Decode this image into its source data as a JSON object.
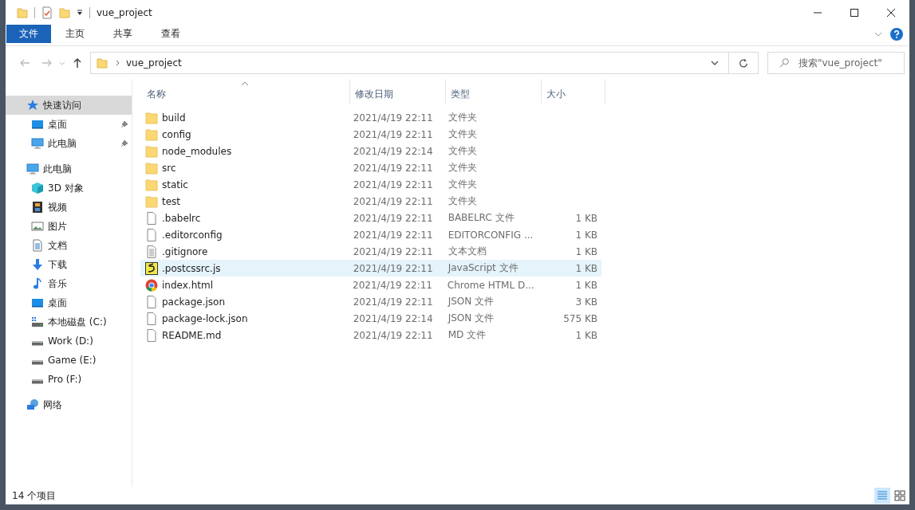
{
  "window": {
    "title": "vue_project"
  },
  "ribbon": {
    "tabs": [
      {
        "label": "文件",
        "selected": true
      },
      {
        "label": "主页",
        "selected": false
      },
      {
        "label": "共享",
        "selected": false
      },
      {
        "label": "查看",
        "selected": false
      }
    ]
  },
  "address": {
    "crumb": "vue_project"
  },
  "search": {
    "placeholder": "搜索\"vue_project\""
  },
  "sidebar": {
    "items": [
      {
        "label": "快速访问",
        "kind": "star",
        "selected": true,
        "pinned": false,
        "children": [
          {
            "label": "桌面",
            "kind": "desktop",
            "selected": false,
            "pinned": true
          },
          {
            "label": "此电脑",
            "kind": "pc",
            "selected": false,
            "pinned": true
          }
        ]
      },
      {
        "label": "此电脑",
        "kind": "pc",
        "selected": false,
        "pinned": false,
        "children": [
          {
            "label": "3D 对象",
            "kind": "cube",
            "selected": false,
            "pinned": false
          },
          {
            "label": "视频",
            "kind": "film",
            "selected": false,
            "pinned": false
          },
          {
            "label": "图片",
            "kind": "image",
            "selected": false,
            "pinned": false
          },
          {
            "label": "文档",
            "kind": "doc",
            "selected": false,
            "pinned": false
          },
          {
            "label": "下载",
            "kind": "download",
            "selected": false,
            "pinned": false
          },
          {
            "label": "音乐",
            "kind": "music",
            "selected": false,
            "pinned": false
          },
          {
            "label": "桌面",
            "kind": "desktop",
            "selected": false,
            "pinned": false
          },
          {
            "label": "本地磁盘 (C:)",
            "kind": "system-drive",
            "selected": false,
            "pinned": false
          },
          {
            "label": "Work (D:)",
            "kind": "drive",
            "selected": false,
            "pinned": false
          },
          {
            "label": "Game (E:)",
            "kind": "drive",
            "selected": false,
            "pinned": false
          },
          {
            "label": "Pro (F:)",
            "kind": "drive",
            "selected": false,
            "pinned": false
          }
        ]
      },
      {
        "label": "网络",
        "kind": "network",
        "selected": false,
        "pinned": false
      }
    ]
  },
  "table": {
    "columns": [
      "名称",
      "修改日期",
      "类型",
      "大小"
    ],
    "rows": [
      {
        "kind": "folder",
        "name": "build",
        "date": "2021/4/19 22:11",
        "type": "文件夹",
        "selected": false
      },
      {
        "kind": "folder",
        "name": "config",
        "date": "2021/4/19 22:11",
        "type": "文件夹",
        "selected": false
      },
      {
        "kind": "folder",
        "name": "node_modules",
        "date": "2021/4/19 22:14",
        "type": "文件夹",
        "selected": false
      },
      {
        "kind": "folder",
        "name": "src",
        "date": "2021/4/19 22:11",
        "type": "文件夹",
        "selected": false
      },
      {
        "kind": "folder",
        "name": "static",
        "date": "2021/4/19 22:11",
        "type": "文件夹",
        "selected": false
      },
      {
        "kind": "folder",
        "name": "test",
        "date": "2021/4/19 22:11",
        "type": "文件夹",
        "selected": false
      },
      {
        "kind": "file",
        "name": ".babelrc",
        "date": "2021/4/19 22:11",
        "type": "BABELRC 文件",
        "size": "1 KB",
        "selected": false
      },
      {
        "kind": "file",
        "name": ".editorconfig",
        "date": "2021/4/19 22:11",
        "type": "EDITORCONFIG ...",
        "size": "1 KB",
        "selected": false
      },
      {
        "kind": "text",
        "name": ".gitignore",
        "date": "2021/4/19 22:11",
        "type": "文本文档",
        "size": "1 KB",
        "selected": false
      },
      {
        "kind": "script",
        "name": ".postcssrc.js",
        "date": "2021/4/19 22:11",
        "type": "JavaScript 文件",
        "size": "1 KB",
        "selected": true
      },
      {
        "kind": "browser",
        "name": "index.html",
        "date": "2021/4/19 22:11",
        "type": "Chrome HTML D...",
        "size": "1 KB",
        "selected": false
      },
      {
        "kind": "file",
        "name": "package.json",
        "date": "2021/4/19 22:11",
        "type": "JSON 文件",
        "size": "3 KB",
        "selected": false
      },
      {
        "kind": "file",
        "name": "package-lock.json",
        "date": "2021/4/19 22:14",
        "type": "JSON 文件",
        "size": "575 KB",
        "selected": false
      },
      {
        "kind": "file",
        "name": "README.md",
        "date": "2021/4/19 22:11",
        "type": "MD 文件",
        "size": "1 KB",
        "selected": false
      }
    ]
  },
  "status_bar": {
    "count": "14 个项目"
  }
}
